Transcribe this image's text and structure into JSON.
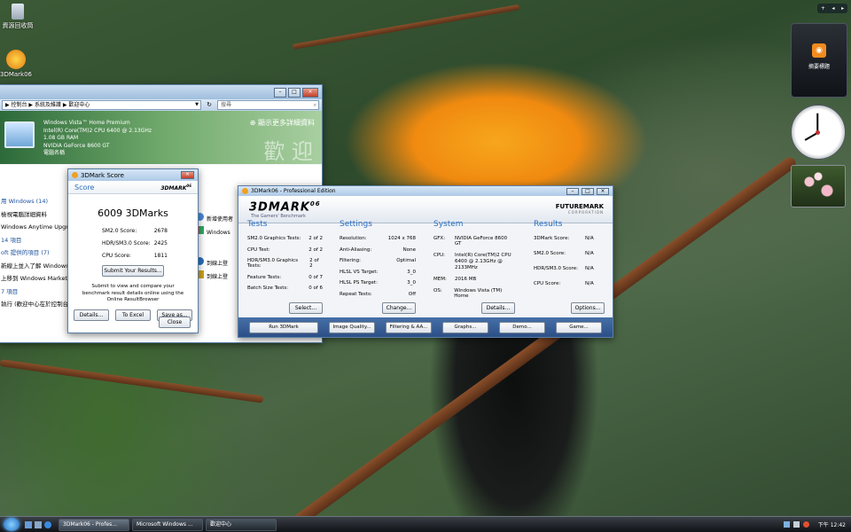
{
  "desktop": {
    "recycle_bin_label": "資源回收筒",
    "app_icon_label": "3DMark06"
  },
  "welcome": {
    "address_breadcrumb": "▶ 控制台 ▶ 系統及維護 ▶ 歡迎中心",
    "search_placeholder": "搜尋",
    "sys_lines": [
      "Windows Vista™ Home Premium",
      "Intel(R) Core(TM)2 CPU       6400  @ 2.13GHz",
      "1.08 GB RAM",
      "NVIDIA GeForce 8600 GT",
      "電腦名稱"
    ],
    "show_more_link": "顯示更多詳細資料",
    "watermark": "歡 迎",
    "left_items": [
      "用 Windows (14)",
      "檢視電腦詳細資料",
      "Windows Anytime Upgrade",
      "14 項目",
      "oft 提供的項目 (7)",
      "新線上並入了解 Windows Li",
      "上移到 Windows Marketpla",
      "7 項目",
      "執行 (歡迎中心在於控制台的系統及維護中)"
    ],
    "right_items": [
      "新增使用者",
      "Windows",
      "到線上登",
      "到線上登",
      "到線上導",
      "的電腦"
    ]
  },
  "score_dialog": {
    "title": "3DMark Score",
    "heading": "Score",
    "brand": "3DMARK",
    "brand_sup": "06",
    "total": "6009 3DMarks",
    "rows": [
      {
        "label": "SM2.0 Score:",
        "value": "2678"
      },
      {
        "label": "HDR/SM3.0 Score:",
        "value": "2425"
      },
      {
        "label": "CPU Score:",
        "value": "1811"
      }
    ],
    "submit_button": "Submit Your Results...",
    "note": "Submit to view and compare your benchmark result details online using the Online ResultBrowser",
    "details_button": "Details...",
    "excel_button": "To Excel",
    "save_button": "Save as...",
    "close_button": "Close"
  },
  "dmark": {
    "title": "3DMark06 - Professional Edition",
    "logo": "3DMARK",
    "logo_sup": "06",
    "tagline": "The Gamers' Benchmark",
    "futuremark": "FUTUREMARK",
    "futuremark_sub": "CORPORATION",
    "tests": {
      "heading": "Tests",
      "rows": [
        {
          "label": "SM2.0 Graphics Tests:",
          "value": "2 of 2"
        },
        {
          "label": "CPU Test:",
          "value": "2 of 2"
        },
        {
          "label": "HDR/SM3.0 Graphics Tests:",
          "value": "2 of 2"
        },
        {
          "label": "Feature Tests:",
          "value": "0 of 7"
        },
        {
          "label": "Batch Size Tests:",
          "value": "0 of 6"
        }
      ],
      "button": "Select..."
    },
    "settings": {
      "heading": "Settings",
      "rows": [
        {
          "label": "Resolution:",
          "value": "1024 x 768"
        },
        {
          "label": "Anti-Aliasing:",
          "value": "None"
        },
        {
          "label": "Filtering:",
          "value": "Optimal"
        },
        {
          "label": "HLSL VS Target:",
          "value": "3_0"
        },
        {
          "label": "HLSL PS Target:",
          "value": "3_0"
        },
        {
          "label": "Repeat Tests:",
          "value": "Off"
        }
      ],
      "button": "Change..."
    },
    "system": {
      "heading": "System",
      "rows": [
        {
          "label": "GFX:",
          "value": "NVIDIA GeForce 8600 GT"
        },
        {
          "label": "CPU:",
          "value": "Intel(R) Core(TM)2 CPU 6400 @ 2.13GHz @ 2133MHz"
        },
        {
          "label": "MEM:",
          "value": "2016 MB"
        },
        {
          "label": "OS:",
          "value": "Windows Vista (TM) Home"
        }
      ],
      "button": "Details..."
    },
    "results": {
      "heading": "Results",
      "rows": [
        {
          "label": "3DMark Score:",
          "value": "N/A"
        },
        {
          "label": "SM2.0 Score:",
          "value": "N/A"
        },
        {
          "label": "HDR/SM3.0 Score:",
          "value": "N/A"
        },
        {
          "label": "CPU Score:",
          "value": "N/A"
        }
      ],
      "button": "Options..."
    },
    "bottom_buttons": [
      "Run 3DMark",
      "Image Quality...",
      "Filtering & AA...",
      "Graphs...",
      "Demo...",
      "Game..."
    ]
  },
  "sidebar": {
    "rss_label": "摘要標題"
  },
  "taskbar": {
    "tasks": [
      "3DMark06 - Profes...",
      "Microsoft Windows ...",
      "歡迎中心"
    ],
    "clock": "下午 12:42"
  }
}
